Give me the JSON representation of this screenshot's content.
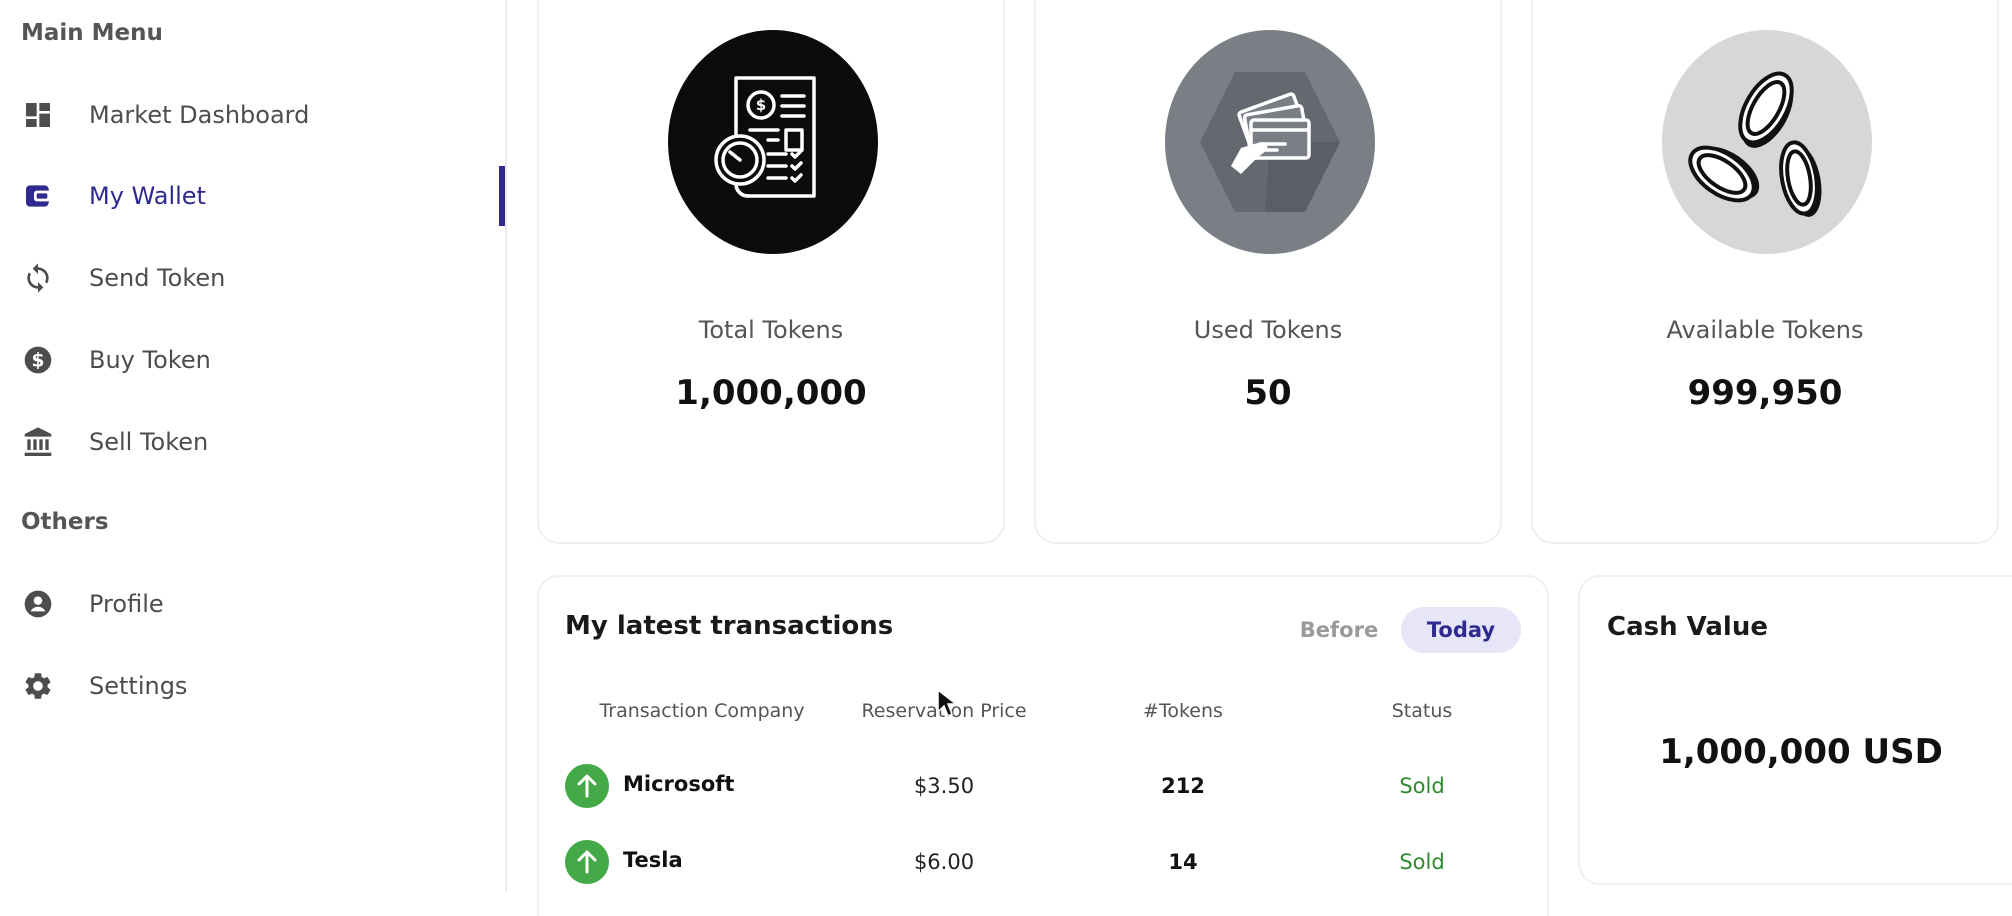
{
  "sidebar": {
    "main_menu_title": "Main Menu",
    "main_items": [
      {
        "label": "Market Dashboard",
        "icon": "dashboard-icon"
      },
      {
        "label": "My Wallet",
        "icon": "wallet-icon",
        "active": true
      },
      {
        "label": "Send Token",
        "icon": "sync-icon"
      },
      {
        "label": "Buy Token",
        "icon": "dollar-icon"
      },
      {
        "label": "Sell Token",
        "icon": "bank-icon"
      }
    ],
    "others_title": "Others",
    "other_items": [
      {
        "label": "Profile",
        "icon": "user-icon"
      },
      {
        "label": "Settings",
        "icon": "gear-icon"
      }
    ],
    "active_color": "#2e2a8f"
  },
  "stats": [
    {
      "label": "Total Tokens",
      "value": "1,000,000",
      "icon": "invoice-icon",
      "circle_color": "#0b0b0b"
    },
    {
      "label": "Used Tokens",
      "value": "50",
      "icon": "cards-icon",
      "circle_color": "#7a7f86"
    },
    {
      "label": "Available Tokens",
      "value": "999,950",
      "icon": "coins-icon",
      "circle_color": "#d6d7d9"
    }
  ],
  "transactions": {
    "title": "My latest transactions",
    "tabs": {
      "before": "Before",
      "today": "Today",
      "selected": "Today"
    },
    "columns": [
      "Transaction Company",
      "Reservation Price",
      "#Tokens",
      "Status"
    ],
    "rows": [
      {
        "company": "Microsoft",
        "price": "$3.50",
        "tokens": "212",
        "status": "Sold",
        "icon": "arrow-up-icon"
      },
      {
        "company": "Tesla",
        "price": "$6.00",
        "tokens": "14",
        "status": "Sold",
        "icon": "arrow-up-icon"
      }
    ],
    "status_color": "#2e8b2e",
    "arrow_color": "#43a947"
  },
  "cash": {
    "title": "Cash Value",
    "value": "1,000,000 USD"
  }
}
